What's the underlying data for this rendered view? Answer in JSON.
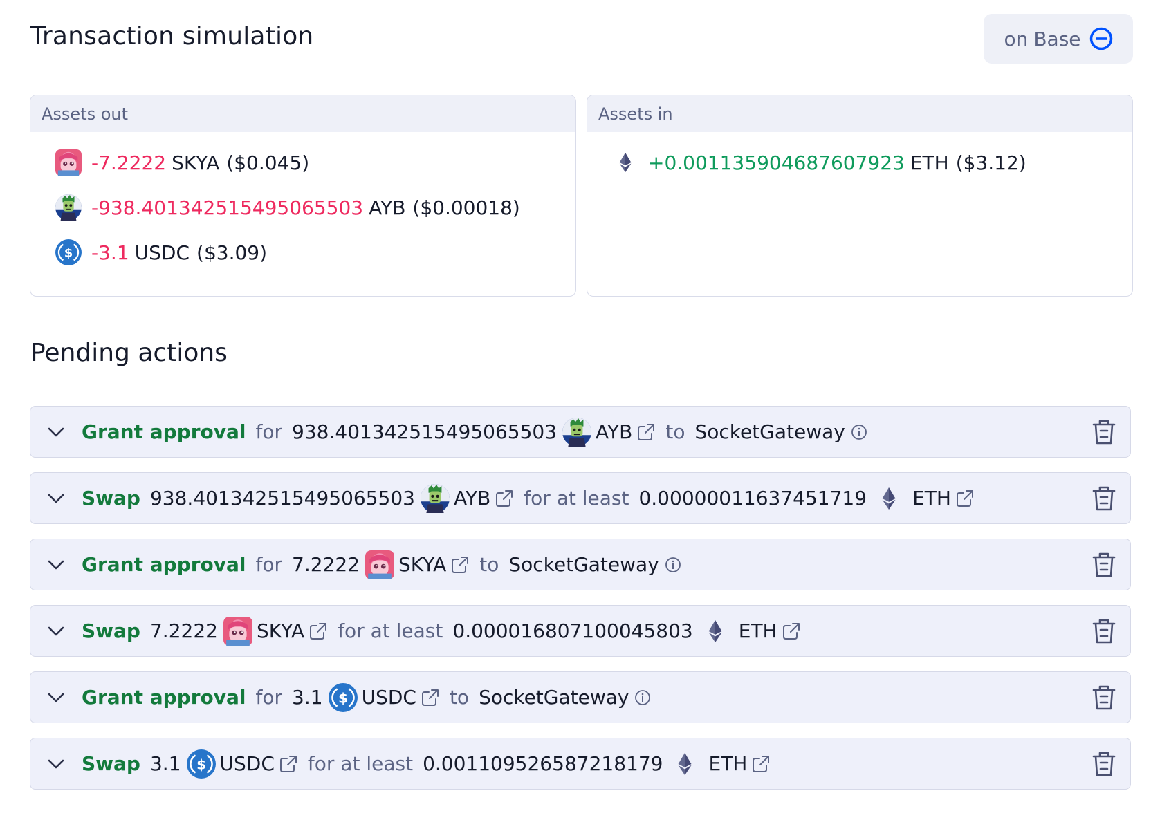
{
  "header": {
    "title": "Transaction simulation",
    "network_prefix": "on",
    "network_name": "Base"
  },
  "assets_out": {
    "label": "Assets out",
    "items": [
      {
        "amount": "-7.2222",
        "symbol": "SKYA",
        "usd": "($0.045)",
        "icon": "skya-token-icon"
      },
      {
        "amount": "-938.401342515495065503",
        "symbol": "AYB",
        "usd": "($0.00018)",
        "icon": "ayb-token-icon"
      },
      {
        "amount": "-3.1",
        "symbol": "USDC",
        "usd": "($3.09)",
        "icon": "usdc-token-icon"
      }
    ]
  },
  "assets_in": {
    "label": "Assets in",
    "items": [
      {
        "amount": "+0.001135904687607923",
        "symbol": "ETH",
        "usd": "($3.12)",
        "icon": "eth-token-icon"
      }
    ]
  },
  "pending": {
    "title": "Pending actions",
    "actions": [
      {
        "type": "approval",
        "verb": "Grant approval",
        "for_word": "for",
        "amount": "938.401342515495065503",
        "symbol": "AYB",
        "to_word": "to",
        "target": "SocketGateway"
      },
      {
        "type": "swap",
        "verb": "Swap",
        "amount": "938.401342515495065503",
        "symbol": "AYB",
        "for_word": "for at least",
        "out_amount": "0.00000011637451719",
        "out_symbol": "ETH"
      },
      {
        "type": "approval",
        "verb": "Grant approval",
        "for_word": "for",
        "amount": "7.2222",
        "symbol": "SKYA",
        "to_word": "to",
        "target": "SocketGateway"
      },
      {
        "type": "swap",
        "verb": "Swap",
        "amount": "7.2222",
        "symbol": "SKYA",
        "for_word": "for at least",
        "out_amount": "0.000016807100045803",
        "out_symbol": "ETH"
      },
      {
        "type": "approval",
        "verb": "Grant approval",
        "for_word": "for",
        "amount": "3.1",
        "symbol": "USDC",
        "to_word": "to",
        "target": "SocketGateway"
      },
      {
        "type": "swap",
        "verb": "Swap",
        "amount": "3.1",
        "symbol": "USDC",
        "for_word": "for at least",
        "out_amount": "0.001109526587218179",
        "out_symbol": "ETH"
      }
    ]
  },
  "colors": {
    "negative": "#ee2a5f",
    "positive": "#0f9b5c",
    "action_verb": "#137a3c",
    "base_blue": "#0052ff"
  }
}
